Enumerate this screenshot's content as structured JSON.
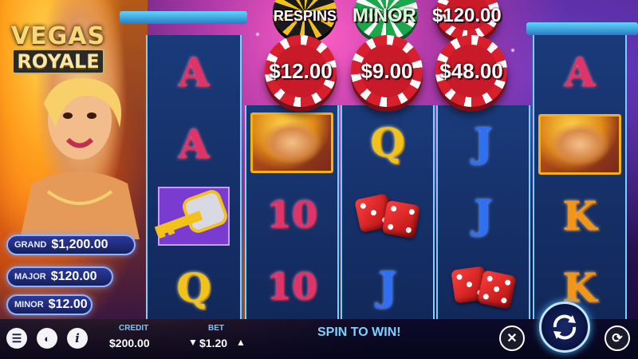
{
  "logo": {
    "line1": "VEGAS",
    "line2": "ROYALE"
  },
  "jackpots": [
    {
      "label": "GRAND",
      "value": "$1,200.00"
    },
    {
      "label": "MAJOR",
      "value": "$120.00"
    },
    {
      "label": "MINOR",
      "value": "$12.00"
    }
  ],
  "top_prizes": {
    "row1": [
      "RESPINS",
      "MINOR",
      "$120.00"
    ],
    "row2": [
      "$12.00",
      "$9.00",
      "$48.00"
    ]
  },
  "reels": [
    [
      "A",
      "A",
      "key"
    ],
    [
      "portrait",
      "10",
      "10"
    ],
    [
      "Q",
      "dice",
      "J"
    ],
    [
      "J",
      "J",
      "dice"
    ],
    [
      "portrait",
      "K",
      "K"
    ]
  ],
  "reel_col0_row3": "Q",
  "bottom": {
    "credit_label": "CREDIT",
    "credit_value": "$200.00",
    "bet_label": "BET",
    "bet_value": "$1.20",
    "message": "SPIN TO WIN!"
  },
  "symbols": {
    "A": "A",
    "Q": "Q",
    "J": "J",
    "K": "K",
    "10": "10"
  },
  "colors": {
    "accent": "#6fd4ff",
    "chip_red": "#d81f2e",
    "chip_green": "#1aa84a",
    "jackpot_border": "#8fb3ff"
  }
}
